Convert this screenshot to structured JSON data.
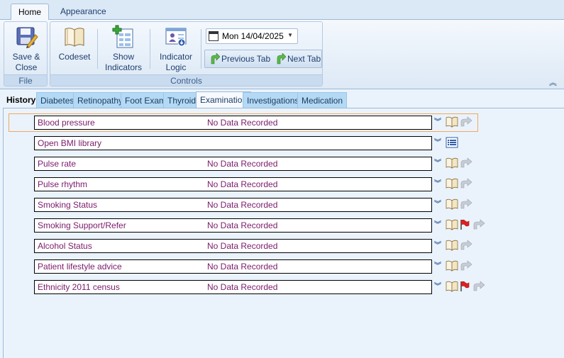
{
  "ribbon_tabs": [
    "Home",
    "Appearance"
  ],
  "ribbon": {
    "save_close": "Save &\nClose",
    "file_label": "File",
    "codeset": "Codeset",
    "show_indicators": "Show\nIndicators",
    "indicator_logic": "Indicator\nLogic",
    "controls_label": "Controls",
    "date": "Mon 14/04/2025",
    "previous_tab": "Previous Tab",
    "next_tab": "Next Tab"
  },
  "content_tabs": [
    "History",
    "Diabetes",
    "Retinopathy",
    "Foot Exam",
    "Thyroid",
    "Examination",
    "Investigations",
    "Medication"
  ],
  "active_tab": "Examination",
  "rows": [
    {
      "name": "Blood pressure",
      "value": "No Data Recorded",
      "icons": [
        "chevron",
        "book",
        "undo"
      ],
      "selected": true
    },
    {
      "name": "Open BMI library",
      "value": "",
      "icons": [
        "chevron",
        "list"
      ]
    },
    {
      "name": "Pulse rate",
      "value": "No Data Recorded",
      "icons": [
        "chevron",
        "book",
        "undo"
      ]
    },
    {
      "name": "Pulse rhythm",
      "value": "No Data Recorded",
      "icons": [
        "chevron",
        "book",
        "undo"
      ]
    },
    {
      "name": "Smoking Status",
      "value": "No Data Recorded",
      "icons": [
        "chevron",
        "book",
        "undo"
      ]
    },
    {
      "name": "Smoking Support/Refer",
      "value": "No Data Recorded",
      "icons": [
        "chevron",
        "book",
        "flag",
        "undo"
      ]
    },
    {
      "name": "Alcohol Status",
      "value": "No Data Recorded",
      "icons": [
        "chevron",
        "book",
        "undo"
      ]
    },
    {
      "name": "Patient lifestyle advice",
      "value": "No Data Recorded",
      "icons": [
        "chevron",
        "book",
        "undo"
      ]
    },
    {
      "name": "Ethnicity 2011 census",
      "value": "No Data Recorded",
      "icons": [
        "chevron",
        "book",
        "flag",
        "undo"
      ]
    }
  ]
}
